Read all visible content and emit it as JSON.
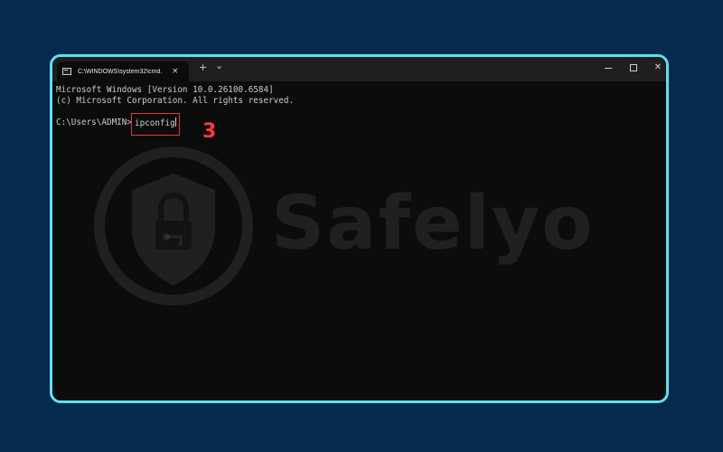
{
  "window": {
    "tab_title": "C:\\WINDOWS\\system32\\cmd.",
    "tab_close": "×",
    "new_tab": "+",
    "dropdown": "⌄",
    "close_symbol": "✕"
  },
  "console": {
    "line1": "Microsoft Windows [Version 10.0.26100.6584]",
    "line2": "(c) Microsoft Corporation. All rights reserved.",
    "prompt": "C:\\Users\\ADMIN>",
    "command": "ipconfig"
  },
  "annotation": {
    "step_number": "3"
  },
  "watermark": {
    "brand": "Safelyo"
  },
  "colors": {
    "background": "#062a4d",
    "frame_border": "#5fe0ee",
    "highlight": "#e23a3a"
  }
}
